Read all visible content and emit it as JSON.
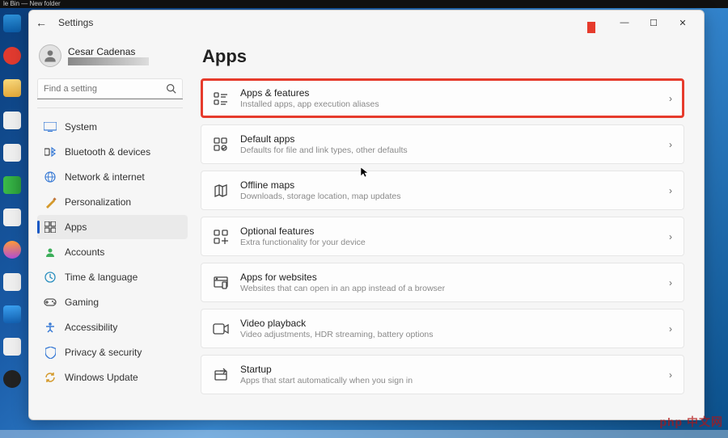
{
  "taskbar_text": "le Bin — New folder",
  "window": {
    "title": "Settings",
    "min": "—",
    "max": "☐",
    "close": "✕"
  },
  "profile": {
    "name": "Cesar Cadenas",
    "email": ""
  },
  "search": {
    "placeholder": "Find a setting"
  },
  "nav": [
    {
      "key": "system",
      "label": "System"
    },
    {
      "key": "bluetooth",
      "label": "Bluetooth & devices"
    },
    {
      "key": "network",
      "label": "Network & internet"
    },
    {
      "key": "personalization",
      "label": "Personalization"
    },
    {
      "key": "apps",
      "label": "Apps",
      "active": true
    },
    {
      "key": "accounts",
      "label": "Accounts"
    },
    {
      "key": "time",
      "label": "Time & language"
    },
    {
      "key": "gaming",
      "label": "Gaming"
    },
    {
      "key": "accessibility",
      "label": "Accessibility"
    },
    {
      "key": "privacy",
      "label": "Privacy & security"
    },
    {
      "key": "update",
      "label": "Windows Update"
    }
  ],
  "page": {
    "title": "Apps"
  },
  "cards": [
    {
      "key": "apps-features",
      "title": "Apps & features",
      "desc": "Installed apps, app execution aliases",
      "highlight": true
    },
    {
      "key": "default-apps",
      "title": "Default apps",
      "desc": "Defaults for file and link types, other defaults"
    },
    {
      "key": "offline-maps",
      "title": "Offline maps",
      "desc": "Downloads, storage location, map updates"
    },
    {
      "key": "optional-features",
      "title": "Optional features",
      "desc": "Extra functionality for your device"
    },
    {
      "key": "apps-websites",
      "title": "Apps for websites",
      "desc": "Websites that can open in an app instead of a browser"
    },
    {
      "key": "video-playback",
      "title": "Video playback",
      "desc": "Video adjustments, HDR streaming, battery options"
    },
    {
      "key": "startup",
      "title": "Startup",
      "desc": "Apps that start automatically when you sign in"
    }
  ],
  "watermark": "php 中文网"
}
